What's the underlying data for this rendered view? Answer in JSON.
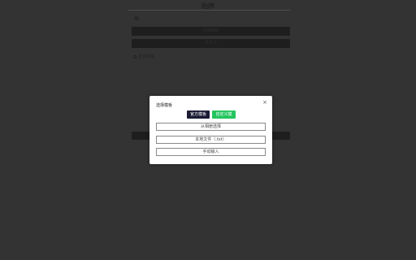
{
  "header": {
    "title": "贴牌",
    "back_icon": "gear-icon"
  },
  "background": {
    "button1_label": "选择模板",
    "button2_label": "自定义",
    "checkbox_label": "显示标签",
    "button3_label": ""
  },
  "modal": {
    "title": "选择模板",
    "close_icon": "close-icon",
    "tabs": [
      {
        "label": "官方模板"
      },
      {
        "label": "自定义模板"
      }
    ],
    "options": [
      {
        "label": "从相册选择"
      },
      {
        "label": "本地文件（.txt）"
      },
      {
        "label": "手动输入"
      }
    ]
  },
  "colors": {
    "backdrop": "#333333",
    "tab_active": "#1a1a33",
    "tab_green": "#22c55e"
  }
}
